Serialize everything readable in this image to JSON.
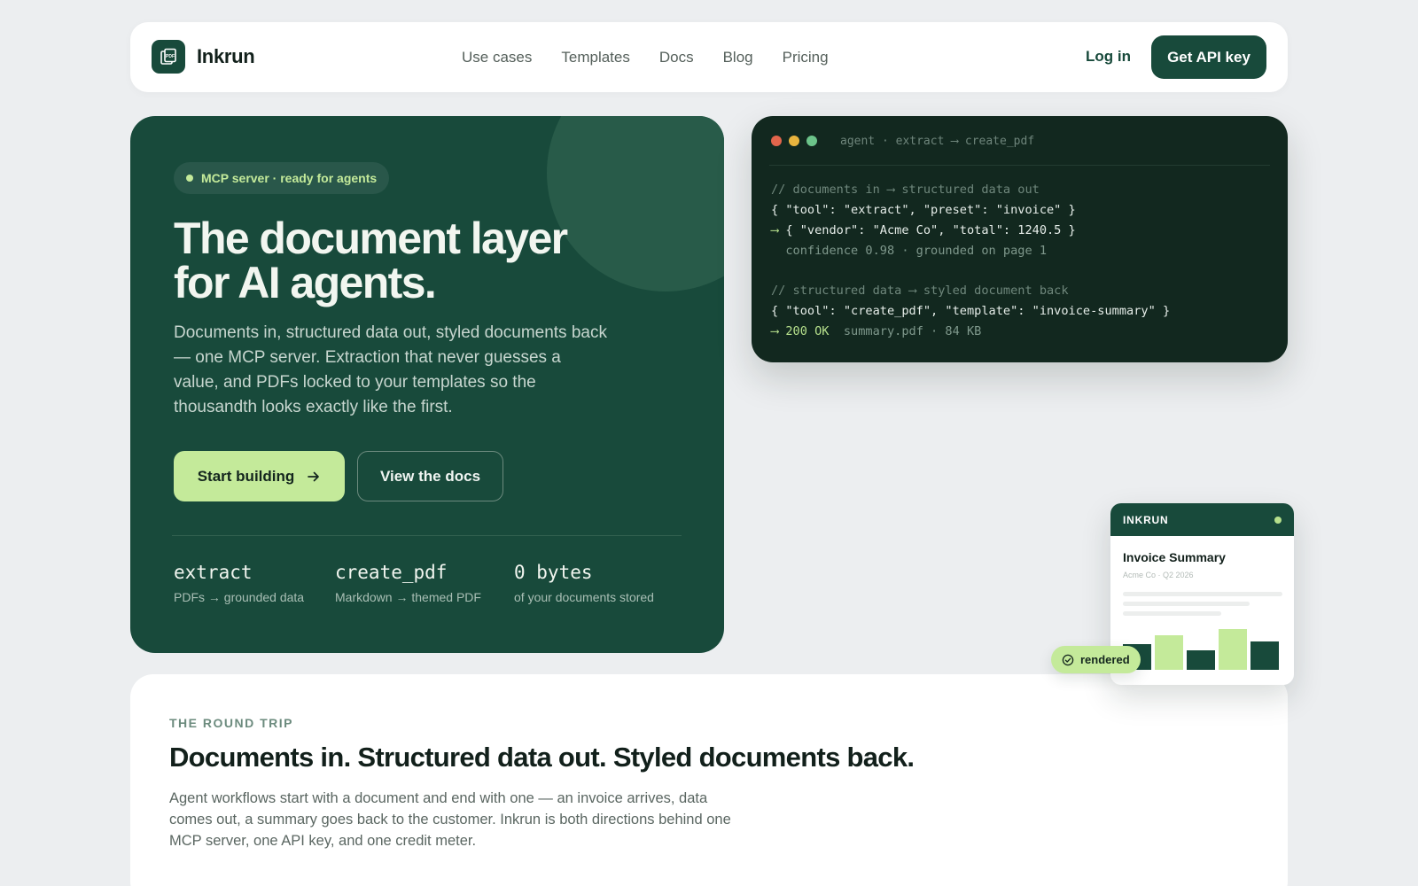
{
  "nav": {
    "brand": "Inkrun",
    "logo_icon": "pdf-document-icon",
    "links": [
      "Use cases",
      "Templates",
      "Docs",
      "Blog",
      "Pricing"
    ],
    "login": "Log in",
    "cta": "Get API key"
  },
  "hero": {
    "badge": "MCP server · ready for agents",
    "title_line1": "The document layer",
    "title_line2": "for AI agents.",
    "description": "Documents in, structured data out, styled documents back — one MCP server. Extraction that never guesses a value, and PDFs locked to your templates so the thousandth looks exactly like the first.",
    "primary_cta": "Start building",
    "primary_cta_icon": "arrow-right-icon",
    "secondary_cta": "View the docs",
    "stats": [
      {
        "value": "extract",
        "label": "PDFs → grounded data"
      },
      {
        "value": "create_pdf",
        "label": "Markdown → themed PDF"
      },
      {
        "value": "0 bytes",
        "label": "of your documents stored"
      }
    ]
  },
  "terminal": {
    "title": "agent · extract ⟶ create_pdf",
    "lines": {
      "c1": "// documents in ⟶ structured data out",
      "l1": "{ \"tool\": \"extract\", \"preset\": \"invoice\" }",
      "l2_arrow": "⟶",
      "l2": " { \"vendor\": \"Acme Co\", \"total\": 1240.5 }",
      "l3": "  confidence 0.98 · grounded on page 1",
      "c2": "// structured data ⟶ styled document back",
      "l4": "{ \"tool\": \"create_pdf\", \"template\": \"invoice-summary\" }",
      "l5_status": "⟶ 200 OK",
      "l5_meta": "  summary.pdf · 84 KB"
    },
    "dot_colors": [
      "#e2654c",
      "#e8b43e",
      "#6cc48a"
    ]
  },
  "card": {
    "brand": "INKRUN",
    "title": "Invoice Summary",
    "subtitle": "Acme Co · Q2 2026",
    "bar_values": [
      0.55,
      0.75,
      0.42,
      0.88,
      0.62
    ],
    "badge": "rendered",
    "badge_icon": "check-circle-icon"
  },
  "section": {
    "eyebrow": "THE ROUND TRIP",
    "title": "Documents in. Structured data out. Styled documents back.",
    "description": "Agent workflows start with a document and end with one — an invoice arrives, data comes out, a summary goes back to the customer. Inkrun is both directions behind one MCP server, one API key, and one credit meter."
  },
  "colors": {
    "brand": "#184a3b",
    "accent": "#c4ea9a",
    "terminal_bg": "#12281f",
    "page_bg": "#eceef0"
  }
}
